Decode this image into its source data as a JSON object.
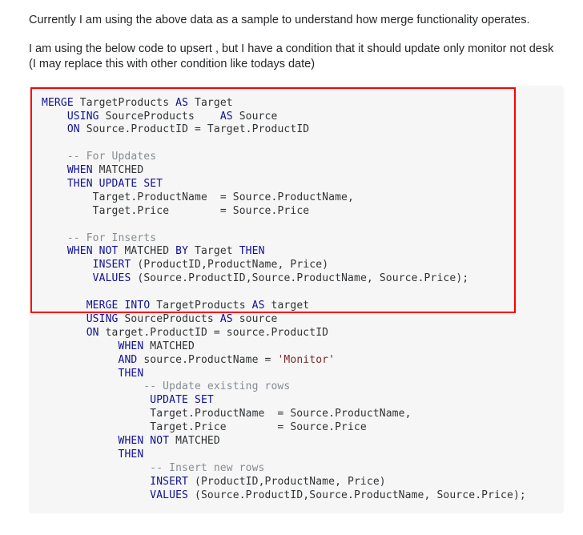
{
  "paragraphs": {
    "p1": "Currently I am using the above data as a sample to understand how merge functionality operates.",
    "p2": "I am using the below code to upsert , but I have a condition that it should update only monitor not desk (I may replace this with other condition like todays date)"
  },
  "code1": {
    "l1_a": "MERGE",
    "l1_b": " TargetProducts ",
    "l1_c": "AS",
    "l1_d": " Target",
    "l2_a": "    ",
    "l2_b": "USING",
    "l2_c": " SourceProducts    ",
    "l2_d": "AS",
    "l2_e": " Source",
    "l3_a": "    ",
    "l3_b": "ON",
    "l3_c": " Source",
    "l3_d": ".",
    "l3_e": "ProductID ",
    "l3_f": "=",
    "l3_g": " Target",
    "l3_h": ".",
    "l3_i": "ProductID",
    "l4": "",
    "l5": "    -- For Updates",
    "l6_a": "    ",
    "l6_b": "WHEN",
    "l6_c": " MATCHED",
    "l7_a": "    ",
    "l7_b": "THEN",
    "l7_c": " ",
    "l7_d": "UPDATE",
    "l7_e": " ",
    "l7_f": "SET",
    "l8_a": "        Target",
    "l8_b": ".",
    "l8_c": "ProductName  ",
    "l8_d": "=",
    "l8_e": " Source",
    "l8_f": ".",
    "l8_g": "ProductName",
    "l8_h": ",",
    "l9_a": "        Target",
    "l9_b": ".",
    "l9_c": "Price        ",
    "l9_d": "=",
    "l9_e": " Source",
    "l9_f": ".",
    "l9_g": "Price",
    "l10": "",
    "l11": "    -- For Inserts",
    "l12_a": "    ",
    "l12_b": "WHEN",
    "l12_c": " ",
    "l12_d": "NOT",
    "l12_e": " MATCHED ",
    "l12_f": "BY",
    "l12_g": " Target ",
    "l12_h": "THEN",
    "l13_a": "        ",
    "l13_b": "INSERT",
    "l13_c": " ",
    "l13_d": "(",
    "l13_e": "ProductID",
    "l13_f": ",",
    "l13_g": "ProductName",
    "l13_h": ",",
    "l13_i": " Price",
    "l13_j": ")",
    "l14_a": "        ",
    "l14_b": "VALUES",
    "l14_c": " ",
    "l14_d": "(",
    "l14_e": "Source",
    "l14_f": ".",
    "l14_g": "ProductID",
    "l14_h": ",",
    "l14_i": "Source",
    "l14_j": ".",
    "l14_k": "ProductName",
    "l14_l": ",",
    "l14_m": " Source",
    "l14_n": ".",
    "l14_o": "Price",
    "l14_p": ");"
  },
  "code2": {
    "l1_a": "       ",
    "l1_b": "MERGE",
    "l1_c": " ",
    "l1_d": "INTO",
    "l1_e": " TargetProducts ",
    "l1_f": "AS",
    "l1_g": " target",
    "l2_a": "       ",
    "l2_b": "USING",
    "l2_c": " SourceProducts ",
    "l2_d": "AS",
    "l2_e": " source",
    "l3_a": "       ",
    "l3_b": "ON",
    "l3_c": " target",
    "l3_d": ".",
    "l3_e": "ProductID ",
    "l3_f": "=",
    "l3_g": " source",
    "l3_h": ".",
    "l3_i": "ProductID",
    "l4_a": "            ",
    "l4_b": "WHEN",
    "l4_c": " MATCHED",
    "l5_a": "            ",
    "l5_b": "AND",
    "l5_c": " source",
    "l5_d": ".",
    "l5_e": "ProductName ",
    "l5_f": "=",
    "l5_g": " ",
    "l5_h": "'Monitor'",
    "l6_a": "            ",
    "l6_b": "THEN",
    "l7": "                -- Update existing rows",
    "l8_a": "                 ",
    "l8_b": "UPDATE",
    "l8_c": " ",
    "l8_d": "SET",
    "l9_a": "                 Target",
    "l9_b": ".",
    "l9_c": "ProductName  ",
    "l9_d": "=",
    "l9_e": " Source",
    "l9_f": ".",
    "l9_g": "ProductName",
    "l9_h": ",",
    "l10_a": "                 Target",
    "l10_b": ".",
    "l10_c": "Price        ",
    "l10_d": "=",
    "l10_e": " Source",
    "l10_f": ".",
    "l10_g": "Price",
    "l11_a": "            ",
    "l11_b": "WHEN",
    "l11_c": " ",
    "l11_d": "NOT",
    "l11_e": " MATCHED",
    "l12_a": "            ",
    "l12_b": "THEN",
    "l13": "                 -- Insert new rows",
    "l14_a": "                 ",
    "l14_b": "INSERT",
    "l14_c": " ",
    "l14_d": "(",
    "l14_e": "ProductID",
    "l14_f": ",",
    "l14_g": "ProductName",
    "l14_h": ",",
    "l14_i": " Price",
    "l14_j": ")",
    "l15_a": "                 ",
    "l15_b": "VALUES",
    "l15_c": " ",
    "l15_d": "(",
    "l15_e": "Source",
    "l15_f": ".",
    "l15_g": "ProductID",
    "l15_h": ",",
    "l15_i": "Source",
    "l15_j": ".",
    "l15_k": "ProductName",
    "l15_l": ",",
    "l15_m": " Source",
    "l15_n": ".",
    "l15_o": "Price",
    "l15_p": ");"
  }
}
